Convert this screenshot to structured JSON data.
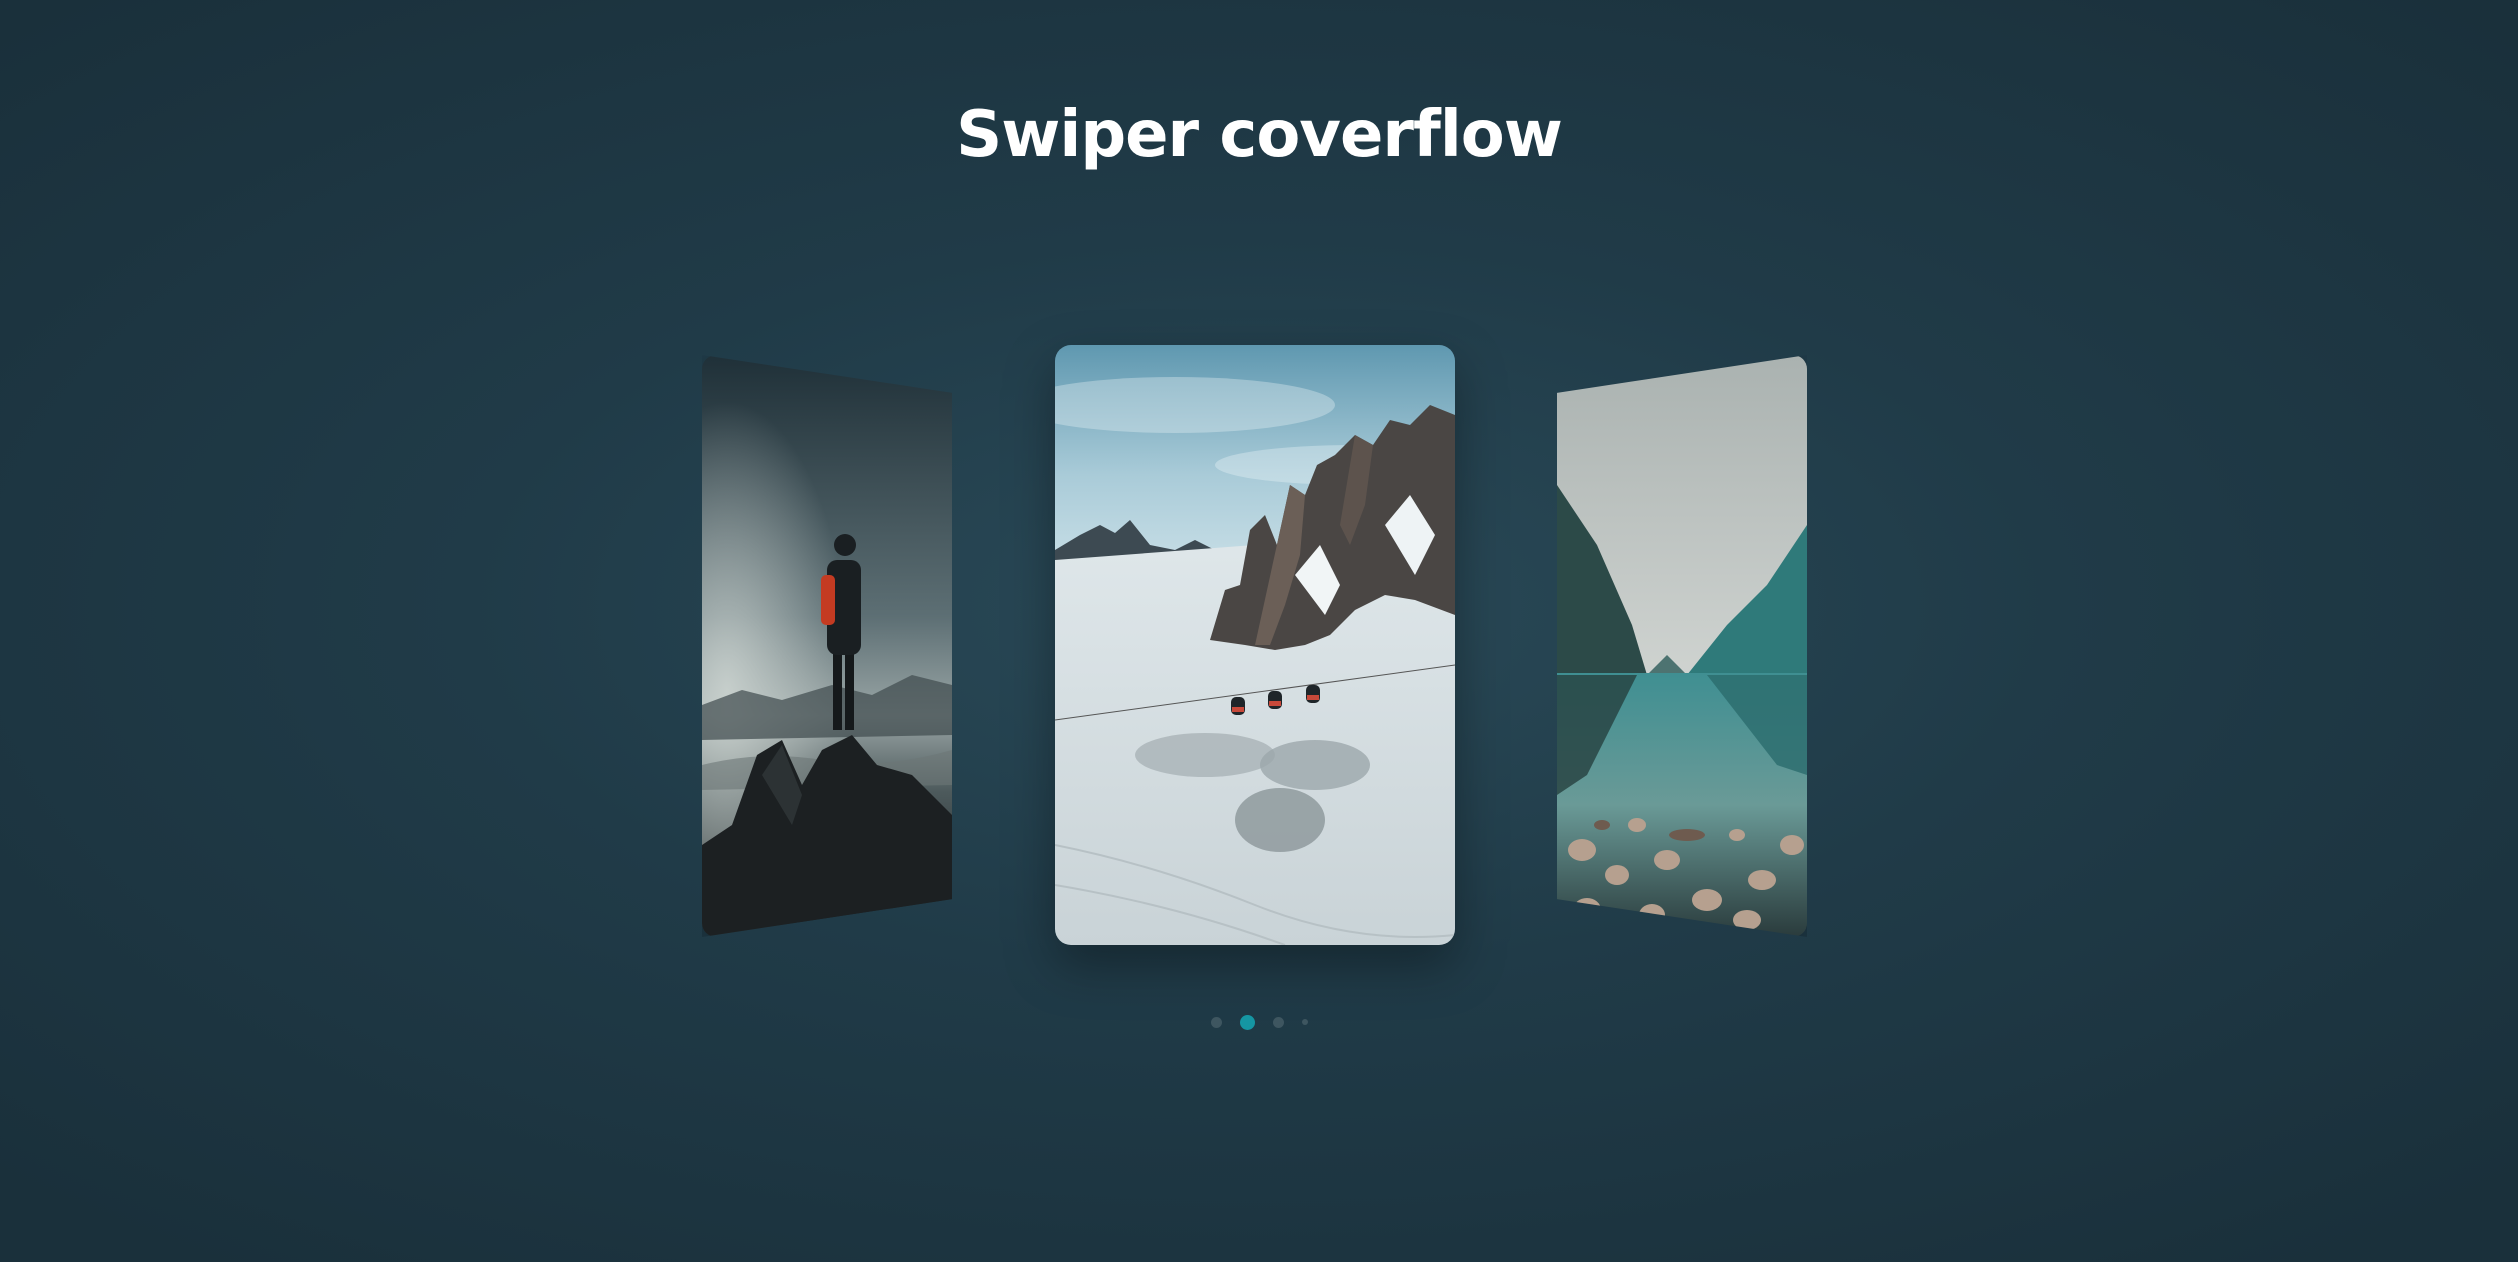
{
  "title": "Swiper coverflow",
  "slides": [
    {
      "icon": "hiker-on-rock-image",
      "state": "previous"
    },
    {
      "icon": "snowy-mountain-cable-car-image",
      "state": "active"
    },
    {
      "icon": "mountain-lake-reflection-image",
      "state": "next"
    }
  ],
  "pagination": {
    "count": 4,
    "active_index": 1,
    "active_color": "#1596a3",
    "inactive_color": "#3e5660"
  },
  "colors": {
    "background": "#203b48",
    "title": "#ffffff"
  }
}
